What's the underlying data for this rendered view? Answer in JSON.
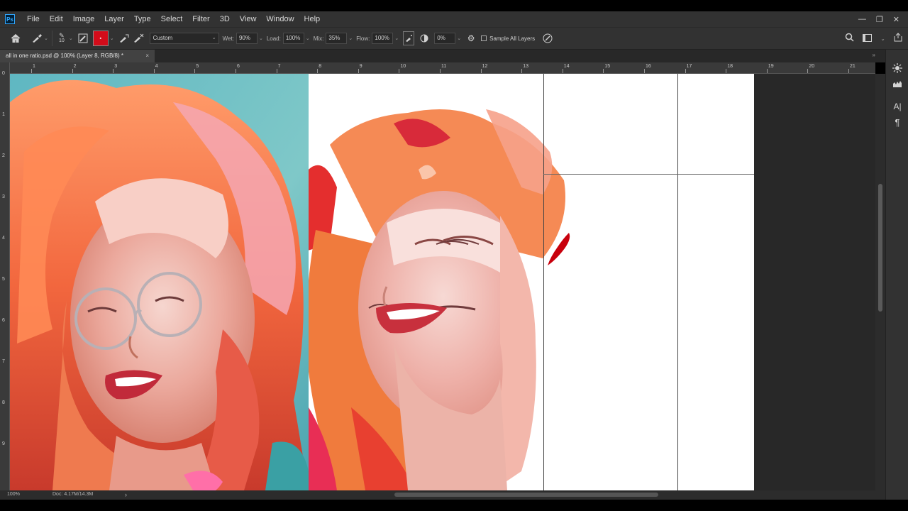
{
  "app": {
    "logo_text": "Ps"
  },
  "menu": [
    "File",
    "Edit",
    "Image",
    "Layer",
    "Type",
    "Select",
    "Filter",
    "3D",
    "View",
    "Window",
    "Help"
  ],
  "window_controls": [
    "—",
    "❐",
    "✕"
  ],
  "options_bar": {
    "brush_size": "10",
    "mixer_preset": "Custom",
    "wet_label": "Wet:",
    "wet_value": "90%",
    "load_label": "Load:",
    "load_value": "100%",
    "mix_label": "Mix:",
    "mix_value": "35%",
    "flow_label": "Flow:",
    "flow_value": "100%",
    "angle_value": "0%",
    "sample_all_layers": "Sample All Layers",
    "foreground_color": "#d30c1a"
  },
  "document_tab": {
    "title": "all in one ratio.psd @ 100% (Layer 8, RGB/8) *",
    "close": "×"
  },
  "tabbar_collapse": "»",
  "ruler": {
    "top_labels": [
      "1",
      "2",
      "3",
      "4",
      "5",
      "6",
      "7",
      "8",
      "9",
      "10",
      "11",
      "12",
      "13",
      "14",
      "15",
      "16",
      "17",
      "18",
      "19",
      "20",
      "21"
    ],
    "left_labels": [
      "0",
      "1",
      "2",
      "3",
      "4",
      "5",
      "6",
      "7",
      "8",
      "9"
    ]
  },
  "status_bar": {
    "zoom": "100%",
    "doc_info": "Doc: 4.17M/14.3M",
    "arrow": "›"
  },
  "colors": {
    "menubar": "#323232",
    "canvas_bg": "#282828",
    "brush_red": "#d30c1a"
  }
}
